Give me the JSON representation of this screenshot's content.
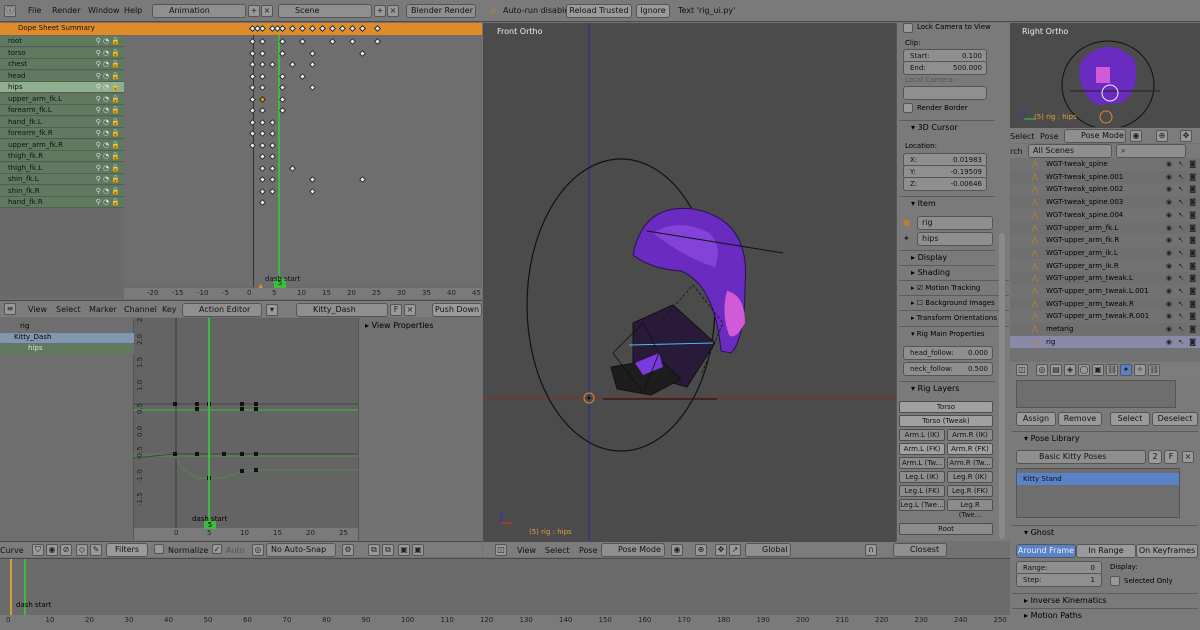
{
  "topbar": {
    "menus": [
      "File",
      "Render",
      "Window",
      "Help"
    ],
    "layout": "Animation",
    "scene": "Scene",
    "engine": "Blender Render",
    "warning": "Auto-run disabled",
    "reload_btn": "Reload Trusted",
    "ignore_btn": "Ignore",
    "script_text": "Text 'rig_ui.py'"
  },
  "dopesheet": {
    "summary": "Dope Sheet Summary",
    "channels": [
      "root",
      "torso",
      "chest",
      "head",
      "hips",
      "upper_arm_fk.L",
      "forearm_fk.L",
      "hand_fk.L",
      "forearm_fk.R",
      "upper_arm_fk.R",
      "thigh_fk.R",
      "thigh_fk.L",
      "shin_fk.L",
      "shin_fk.R",
      "hand_fk.R"
    ],
    "ticks": [
      "-20",
      "-15",
      "-10",
      "-5",
      "0",
      "5",
      "10",
      "15",
      "20",
      "25",
      "30",
      "35",
      "40",
      "45"
    ],
    "marker": "dash start",
    "current_frame": "5",
    "menus": [
      "View",
      "Select",
      "Marker",
      "Channel",
      "Key"
    ],
    "mode": "Action Editor",
    "action": "Kitty_Dash",
    "push_down": "Push Down"
  },
  "graph": {
    "channels": [
      "rig",
      "Kitty_Dash",
      "hips"
    ],
    "view_props": "View Properties",
    "yticks": [
      "2.5",
      "2.0",
      "1.5",
      "1.0",
      "0.5",
      "0.0",
      "-0.5",
      "-1.0",
      "-1.5"
    ],
    "xticks": [
      "0",
      "5",
      "10",
      "15",
      "20",
      "25"
    ],
    "marker": "dash start",
    "current_frame": "5",
    "header_mode": "Curve",
    "filters": "Filters",
    "normalize": "Normalize",
    "auto": "Auto",
    "snap": "No Auto-Snap"
  },
  "viewport": {
    "title": "Front Ortho",
    "status": "(5) rig : hips",
    "menus": [
      "View",
      "Select",
      "Pose"
    ],
    "mode": "Pose Mode",
    "orientation": "Global",
    "pivot": "Closest"
  },
  "npanel": {
    "lock_camera": "Lock Camera to View",
    "clip_label": "Clip:",
    "clip_start_label": "Start:",
    "clip_start": "0.100",
    "clip_end_label": "End:",
    "clip_end": "500.000",
    "local_camera": "Local Camera:",
    "render_border": "Render Border",
    "cursor_title": "3D Cursor",
    "location_label": "Location:",
    "x_label": "X:",
    "x": "0.01983",
    "y_label": "Y:",
    "y": "-0.19509",
    "z_label": "Z:",
    "z": "-0.00646",
    "item_title": "Item",
    "item_object": "rig",
    "item_bone": "hips",
    "display": "Display",
    "shading": "Shading",
    "motion_tracking": "Motion Tracking",
    "background_images": "Background Images",
    "transform_orientations": "Transform Orientations",
    "rig_main_props": "Rig Main Properties",
    "head_follow_label": "head_follow:",
    "head_follow": "0.000",
    "neck_follow_label": "neck_follow:",
    "neck_follow": "0.500",
    "rig_layers": "Rig Layers",
    "layers": [
      [
        "Torso"
      ],
      [
        "Torso (Tweak)"
      ],
      [
        "Arm.L (IK)",
        "Arm.R (IK)"
      ],
      [
        "Arm.L (FK)",
        "Arm.R (FK)"
      ],
      [
        "Arm.L (Tw...",
        "Arm.R (Tw..."
      ],
      [
        "Leg.L (IK)",
        "Leg.R (IK)"
      ],
      [
        "Leg.L (FK)",
        "Leg.R (FK)"
      ],
      [
        "Leg.L (Twe...",
        "Leg.R (Twe..."
      ],
      [
        "Root"
      ]
    ]
  },
  "right_view": {
    "title": "Right Ortho",
    "status": "(5) rig : hips"
  },
  "outliner": {
    "menus": [
      "Select",
      "Pose"
    ],
    "mode": "Pose Mode",
    "search_label": "rch",
    "scenes": "All Scenes",
    "rows": [
      "WGT-tweak_spine",
      "WGT-tweak_spine.001",
      "WGT-tweak_spine.002",
      "WGT-tweak_spine.003",
      "WGT-tweak_spine.004",
      "WGT-upper_arm_fk.L",
      "WGT-upper_arm_fk.R",
      "WGT-upper_arm_ik.L",
      "WGT-upper_arm_ik.R",
      "WGT-upper_arm_tweak.L",
      "WGT-upper_arm_tweak.L.001",
      "WGT-upper_arm_tweak.R",
      "WGT-upper_arm_tweak.R.001",
      "metarig",
      "rig"
    ]
  },
  "properties": {
    "assign": "Assign",
    "remove": "Remove",
    "select": "Select",
    "deselect": "Deselect",
    "pose_library": "Pose Library",
    "library_name": "Basic Kitty Poses",
    "library_users": "2",
    "library_f": "F",
    "pose_item": "Kitty Stand",
    "ghost": "Ghost",
    "ghost_tabs": [
      "Around Frame",
      "In Range",
      "On Keyframes"
    ],
    "range_label": "Range:",
    "range": "0",
    "step_label": "Step:",
    "step": "1",
    "display_label": "Display:",
    "selected_only": "Selected Only",
    "inverse_kinematics": "Inverse Kinematics",
    "motion_paths": "Motion Paths"
  },
  "timeline": {
    "ticks": [
      "0",
      "10",
      "20",
      "30",
      "40",
      "50",
      "60",
      "70",
      "80",
      "90",
      "100",
      "110",
      "120",
      "130",
      "140",
      "150",
      "160",
      "170",
      "180",
      "190",
      "200",
      "210",
      "220",
      "230",
      "240",
      "250"
    ],
    "marker": "dash start"
  },
  "colors": {
    "accent_orange": "#e08a2a",
    "channel_green": "#5f7a5f",
    "frame_green": "#3dbb3d",
    "selected_blue": "#5a82c8"
  }
}
